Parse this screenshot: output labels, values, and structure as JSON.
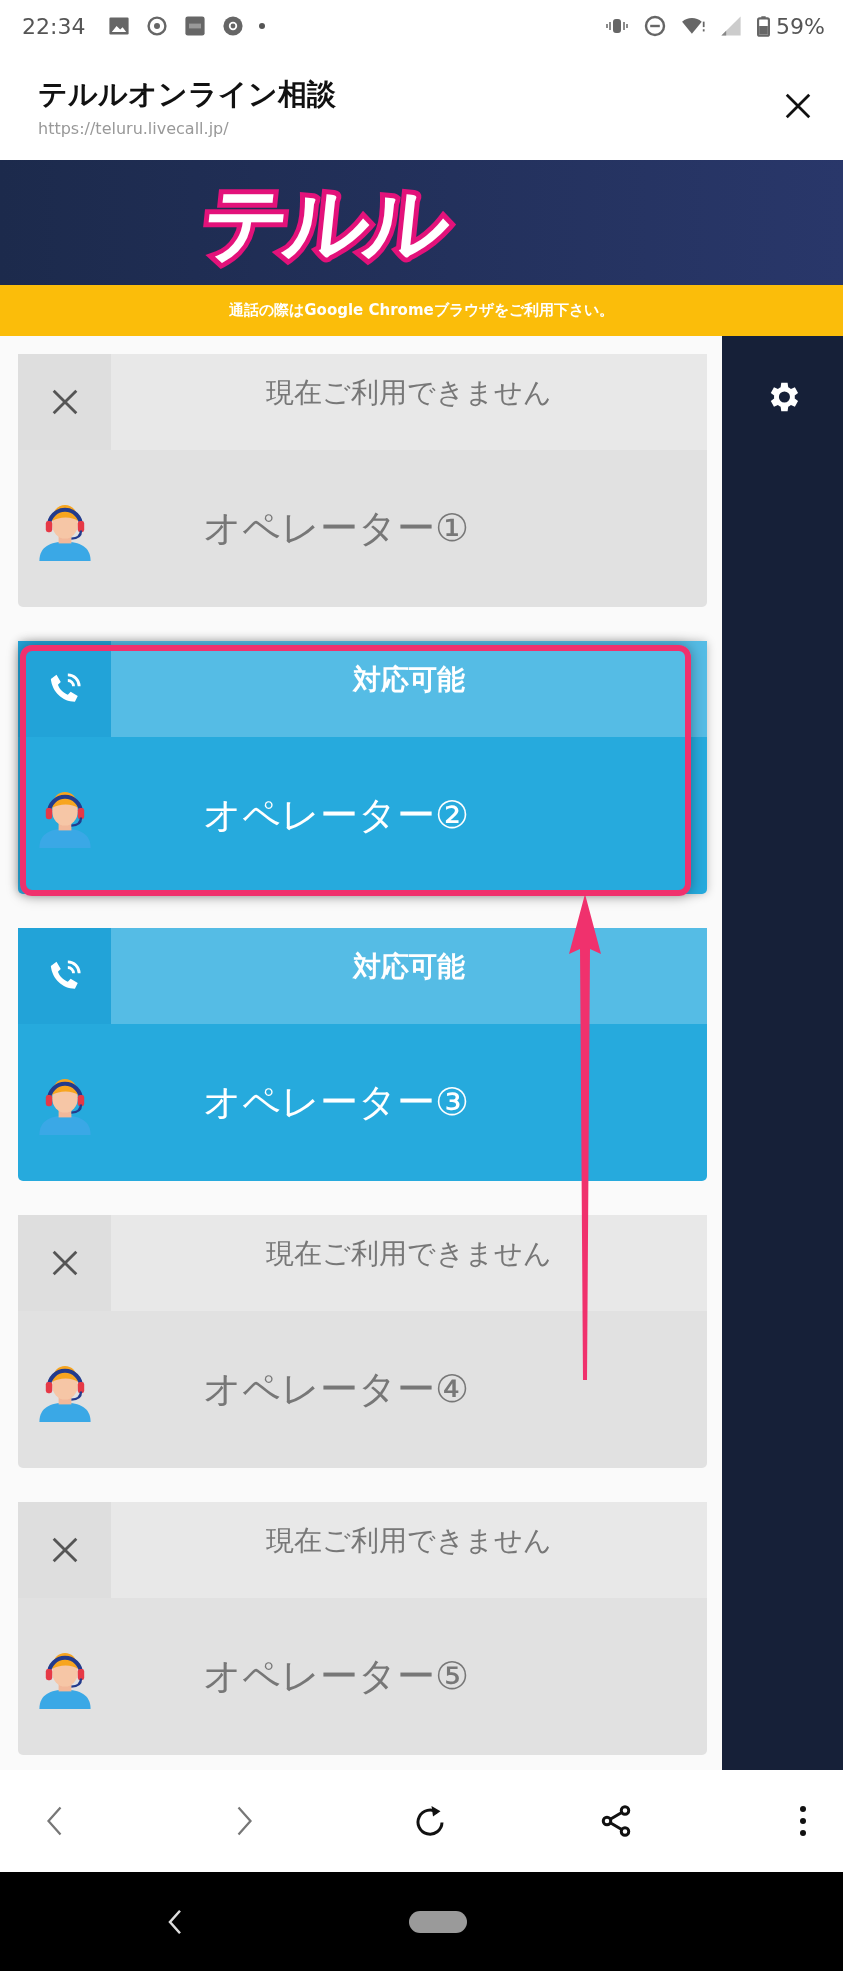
{
  "status_bar": {
    "time": "22:34",
    "battery": "59%"
  },
  "header": {
    "title": "テルルオンライン相談",
    "url": "https://teluru.livecall.jp/"
  },
  "logo": {
    "text": "テルル"
  },
  "notice": "通話の際はGoogle Chromeブラウザをご利用下さい。",
  "operators": [
    {
      "kind": "unavailable",
      "status": "現在ご利用できません",
      "name": "オペレーター①",
      "highlighted": false
    },
    {
      "kind": "available",
      "status": "対応可能",
      "name": "オペレーター②",
      "highlighted": true
    },
    {
      "kind": "available",
      "status": "対応可能",
      "name": "オペレーター③",
      "highlighted": false
    },
    {
      "kind": "unavailable",
      "status": "現在ご利用できません",
      "name": "オペレーター④",
      "highlighted": false
    },
    {
      "kind": "unavailable",
      "status": "現在ご利用できません",
      "name": "オペレーター⑤",
      "highlighted": false
    }
  ]
}
